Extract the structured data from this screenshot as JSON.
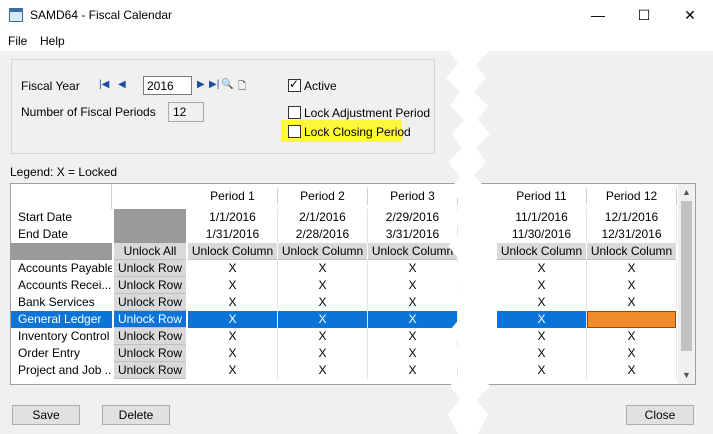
{
  "window": {
    "title": "SAMD64 - Fiscal Calendar",
    "minimize": "—",
    "maximize": "☐",
    "close": "✕"
  },
  "menu": {
    "items": [
      "File",
      "Help"
    ]
  },
  "form": {
    "fiscal_year_label": "Fiscal Year",
    "fiscal_year_value": "2016",
    "num_periods_label": "Number of Fiscal Periods",
    "num_periods_value": "12",
    "active_label": "Active",
    "active_checked": true,
    "lock_adjustment_label": "Lock Adjustment Period",
    "lock_adjustment_checked": false,
    "lock_closing_label": "Lock Closing Period",
    "lock_closing_checked": false
  },
  "legend": "Legend: X = Locked",
  "grid": {
    "period_headers": [
      "Period 1",
      "Period 2",
      "Period 3",
      "Period 11",
      "Period 12"
    ],
    "start_date_label": "Start Date",
    "end_date_label": "End Date",
    "start_dates": [
      "1/1/2016",
      "2/1/2016",
      "2/29/2016",
      "11/1/2016",
      "12/1/2016"
    ],
    "end_dates": [
      "1/31/2016",
      "2/28/2016",
      "3/31/2016",
      "11/30/2016",
      "12/31/2016"
    ],
    "unlock_all": "Unlock All",
    "unlock_column": "Unlock Column",
    "unlock_row": "Unlock Row",
    "rows": [
      {
        "label": "Accounts Payable",
        "values": [
          "X",
          "X",
          "X",
          "X",
          "X"
        ]
      },
      {
        "label": "Accounts Recei...",
        "values": [
          "X",
          "X",
          "X",
          "X",
          "X"
        ]
      },
      {
        "label": "Bank Services",
        "values": [
          "X",
          "X",
          "X",
          "X",
          "X"
        ]
      },
      {
        "label": "General Ledger",
        "values": [
          "X",
          "X",
          "X",
          "X",
          ""
        ]
      },
      {
        "label": "Inventory Control",
        "values": [
          "X",
          "X",
          "X",
          "X",
          "X"
        ]
      },
      {
        "label": "Order Entry",
        "values": [
          "X",
          "X",
          "X",
          "X",
          "X"
        ]
      },
      {
        "label": "Project and Job ...",
        "values": [
          "X",
          "X",
          "X",
          "X",
          "X"
        ]
      }
    ]
  },
  "buttons": {
    "save": "Save",
    "delete": "Delete",
    "close": "Close"
  },
  "colors": {
    "selection": "#0a74d9",
    "highlight": "#fff83a",
    "orange_cell": "#f28b2c"
  }
}
